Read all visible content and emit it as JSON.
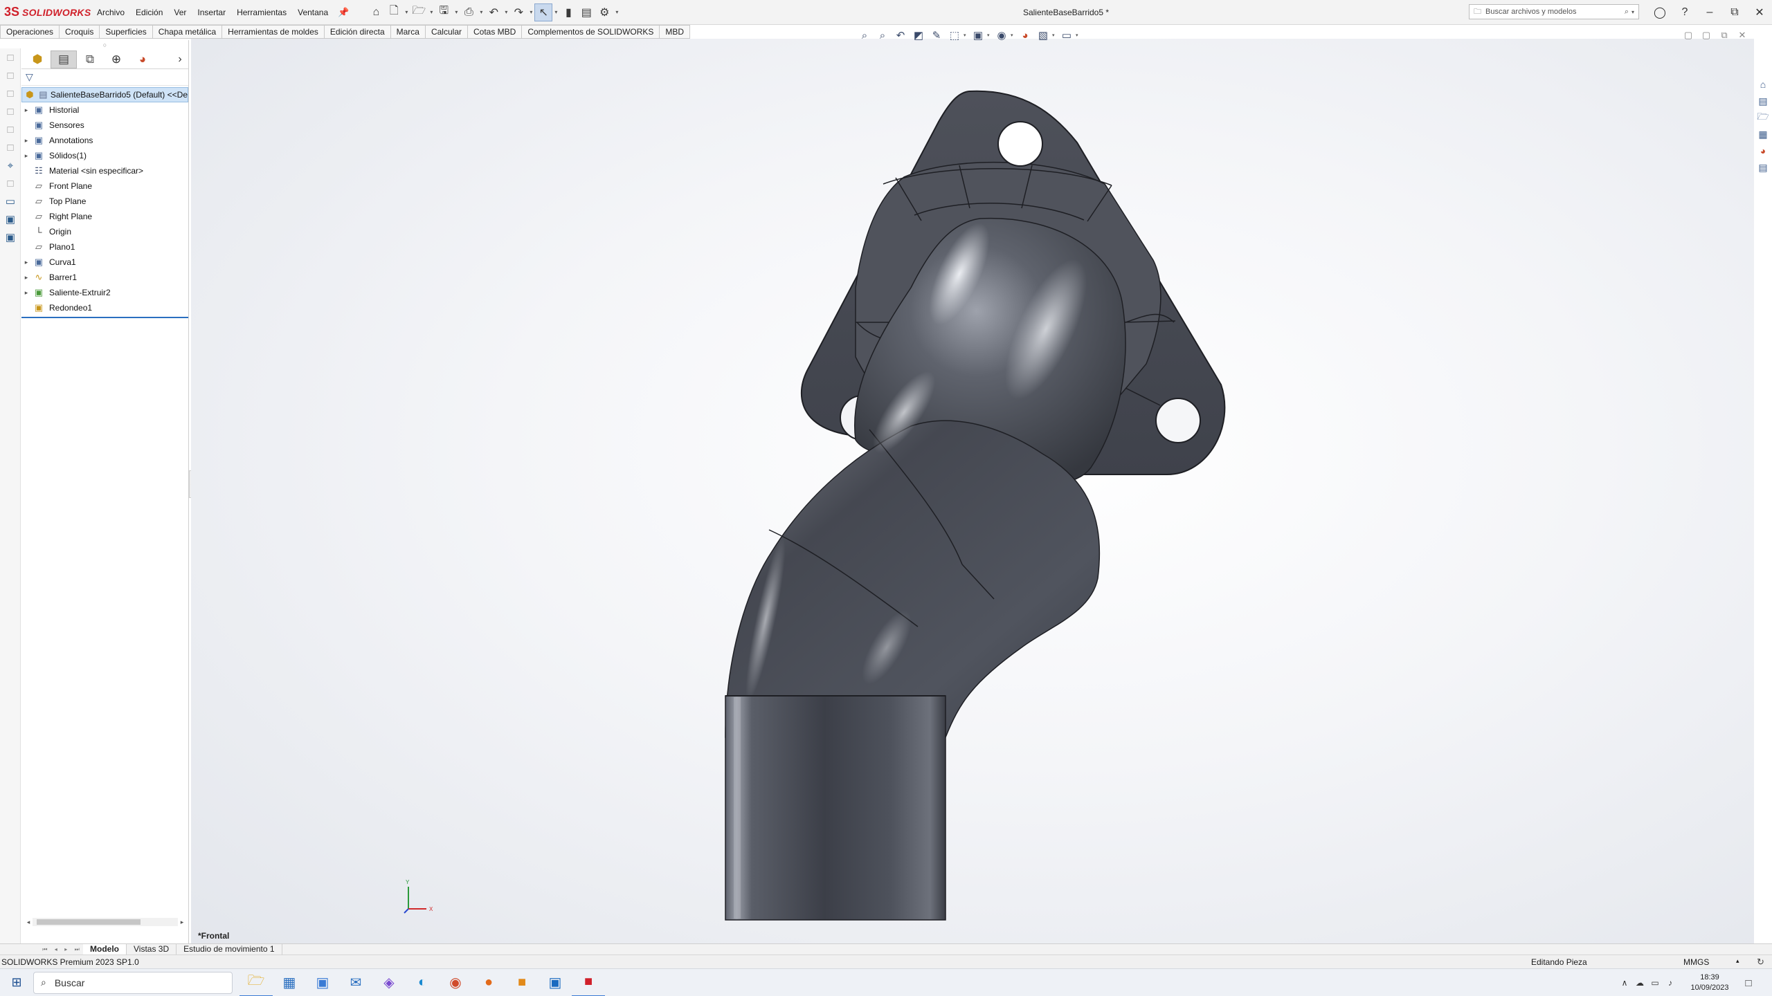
{
  "app": {
    "logo_mark": "3S",
    "logo_text": "SOLIDWORKS",
    "document_title": "SalienteBaseBarrido5 *"
  },
  "menu": [
    "Archivo",
    "Edición",
    "Ver",
    "Insertar",
    "Herramientas",
    "Ventana"
  ],
  "search": {
    "placeholder": "Buscar archivos y modelos"
  },
  "command_tabs": [
    "Operaciones",
    "Croquis",
    "Superficies",
    "Chapa metálica",
    "Herramientas de moldes",
    "Edición directa",
    "Marca",
    "Calcular",
    "Cotas MBD",
    "Complementos de SOLIDWORKS",
    "MBD"
  ],
  "feature_tree": {
    "root": "SalienteBaseBarrido5 (Default) <<De",
    "items": [
      {
        "label": "Historial",
        "expand": true,
        "icon": "history-icon"
      },
      {
        "label": "Sensores",
        "expand": false,
        "icon": "sensor-icon"
      },
      {
        "label": "Annotations",
        "expand": true,
        "icon": "annotations-icon"
      },
      {
        "label": "Sólidos(1)",
        "expand": true,
        "icon": "solid-bodies-icon"
      },
      {
        "label": "Material <sin especificar>",
        "expand": false,
        "icon": "material-icon"
      },
      {
        "label": "Front Plane",
        "expand": false,
        "icon": "plane-icon"
      },
      {
        "label": "Top Plane",
        "expand": false,
        "icon": "plane-icon"
      },
      {
        "label": "Right Plane",
        "expand": false,
        "icon": "plane-icon"
      },
      {
        "label": "Origin",
        "expand": false,
        "icon": "origin-icon"
      },
      {
        "label": "Plano1",
        "expand": false,
        "icon": "plane-icon"
      },
      {
        "label": "Curva1",
        "expand": true,
        "icon": "curve-icon"
      },
      {
        "label": "Barrer1",
        "expand": true,
        "icon": "sweep-icon"
      },
      {
        "label": "Saliente-Extruir2",
        "expand": true,
        "icon": "extrude-icon"
      },
      {
        "label": "Redondeo1",
        "expand": false,
        "icon": "fillet-icon"
      }
    ]
  },
  "viewport": {
    "view_name": "*Frontal",
    "triad": {
      "y": "Y",
      "x": "X"
    }
  },
  "bottom_tabs": [
    "Modelo",
    "Vistas 3D",
    "Estudio de movimiento 1"
  ],
  "status": {
    "version": "SOLIDWORKS Premium 2023 SP1.0",
    "mode": "Editando Pieza",
    "units": "MMGS"
  },
  "taskbar": {
    "search_label": "Buscar",
    "time": "18:39",
    "date": "10/09/2023"
  },
  "colors": {
    "brand": "#d0202a",
    "selection": "#cfe3f7",
    "model_body": "#4a4d56"
  }
}
